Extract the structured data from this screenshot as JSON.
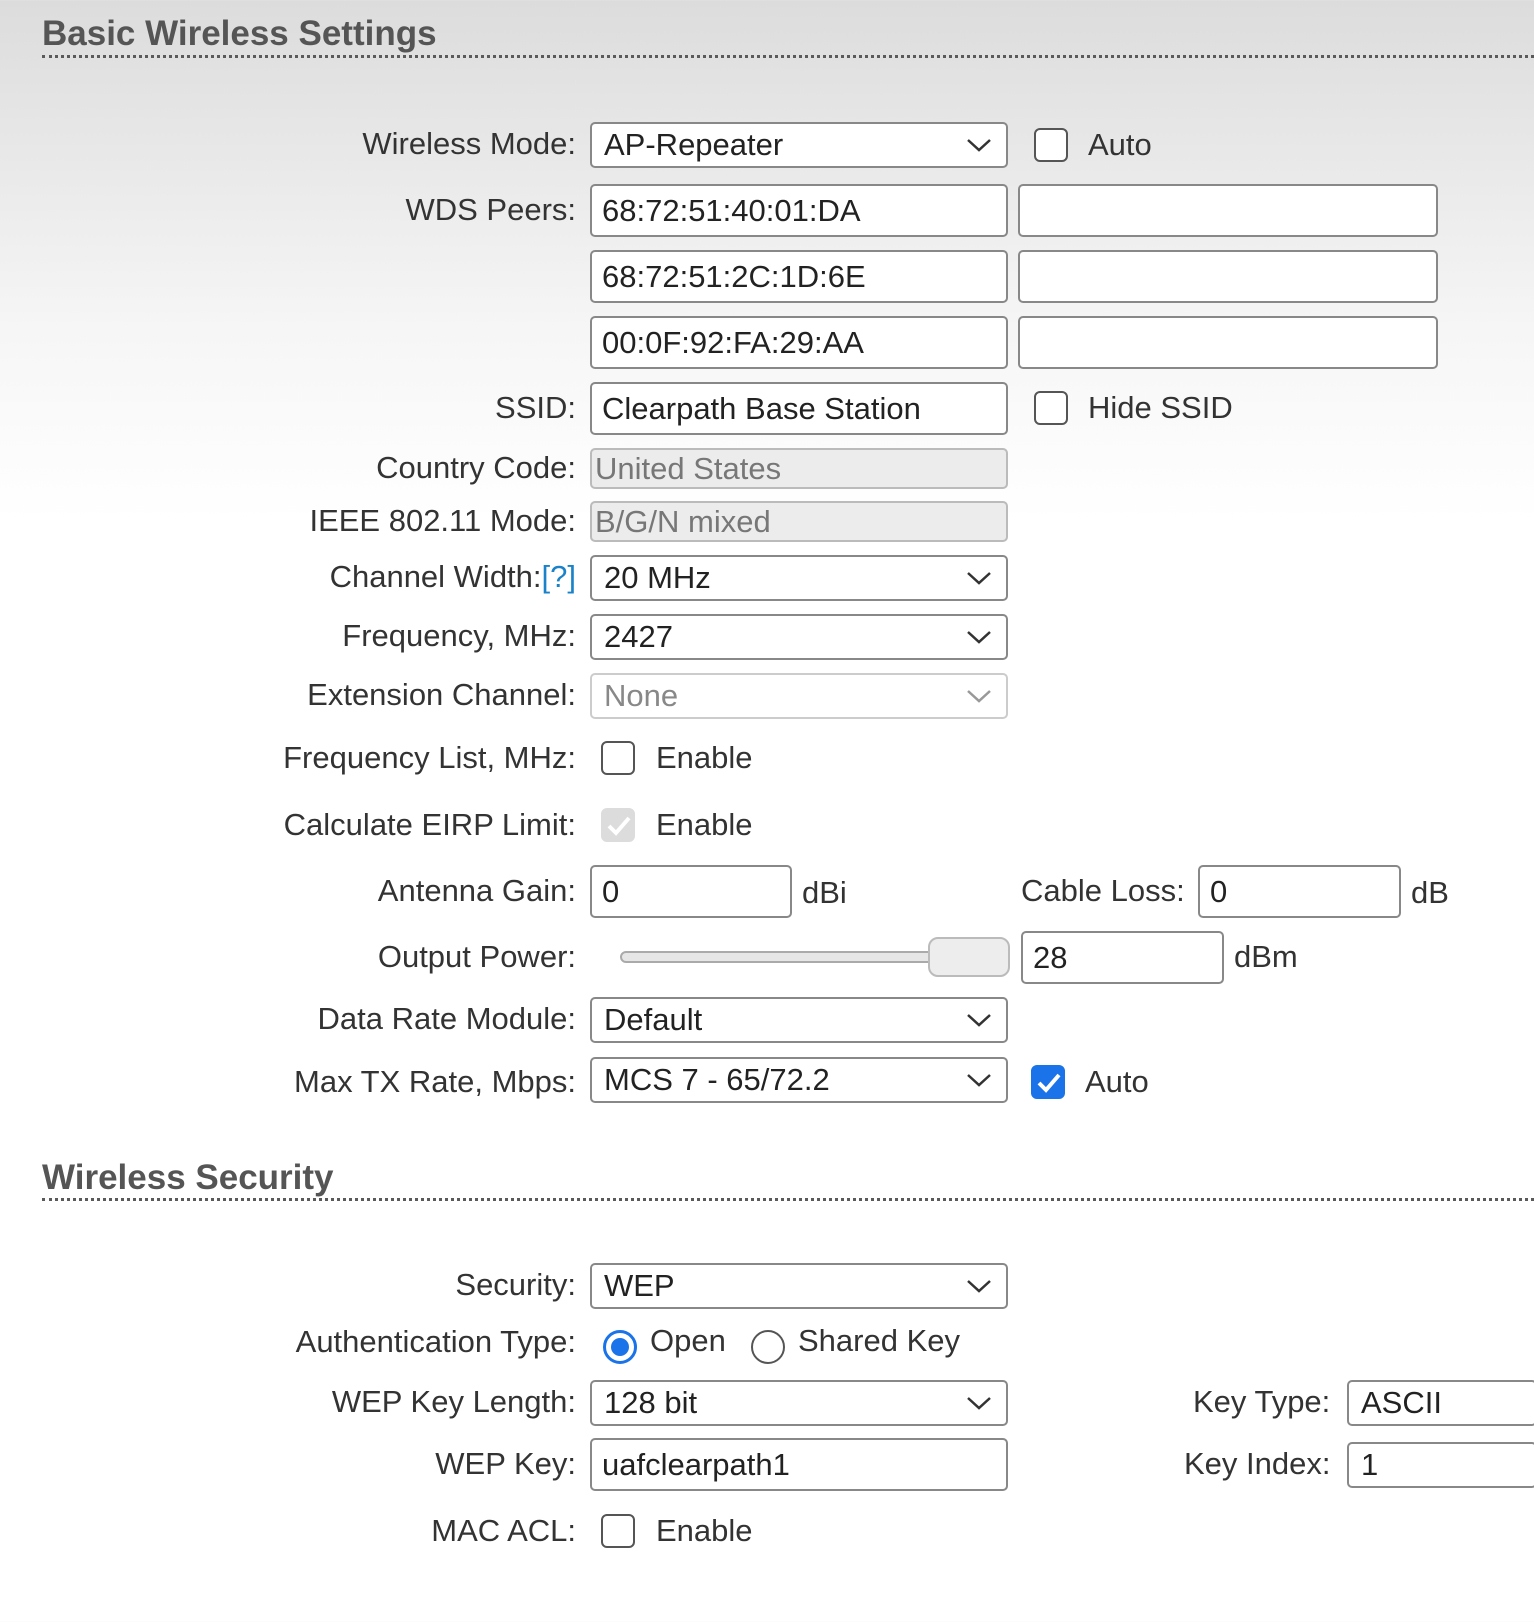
{
  "basic": {
    "title": "Basic Wireless Settings",
    "wireless_mode": {
      "label": "Wireless Mode:",
      "value": "AP-Repeater",
      "auto_label": "Auto",
      "auto_checked": false
    },
    "wds_peers": {
      "label": "WDS Peers:",
      "values": [
        "68:72:51:40:01:DA",
        "68:72:51:2C:1D:6E",
        "00:0F:92:FA:29:AA",
        "",
        "",
        ""
      ]
    },
    "ssid": {
      "label": "SSID:",
      "value": "Clearpath Base Station",
      "hide_label": "Hide SSID",
      "hide_checked": false
    },
    "country_code": {
      "label": "Country Code:",
      "value": "United States"
    },
    "ieee_mode": {
      "label": "IEEE 802.11 Mode:",
      "value": "B/G/N mixed"
    },
    "channel_width": {
      "label": "Channel Width:",
      "help": "[?]",
      "value": "20 MHz"
    },
    "frequency": {
      "label": "Frequency, MHz:",
      "value": "2427"
    },
    "extension_channel": {
      "label": "Extension Channel:",
      "value": "None"
    },
    "frequency_list": {
      "label": "Frequency List, MHz:",
      "enable_label": "Enable",
      "checked": false
    },
    "eirp_limit": {
      "label": "Calculate EIRP Limit:",
      "enable_label": "Enable",
      "checked": true
    },
    "antenna_gain": {
      "label": "Antenna Gain:",
      "value": "0",
      "unit": "dBi"
    },
    "cable_loss": {
      "label": "Cable Loss:",
      "value": "0",
      "unit": "dB"
    },
    "output_power": {
      "label": "Output Power:",
      "value": "28",
      "unit": "dBm",
      "slider_fraction": 1.0
    },
    "data_rate_module": {
      "label": "Data Rate Module:",
      "value": "Default"
    },
    "max_tx_rate": {
      "label": "Max TX Rate, Mbps:",
      "value": "MCS 7 - 65/72.2",
      "auto_label": "Auto",
      "auto_checked": true
    }
  },
  "security": {
    "title": "Wireless Security",
    "security": {
      "label": "Security:",
      "value": "WEP"
    },
    "auth_type": {
      "label": "Authentication Type:",
      "options": [
        "Open",
        "Shared Key"
      ],
      "selected": "Open"
    },
    "wep_key_length": {
      "label": "WEP Key Length:",
      "value": "128 bit"
    },
    "key_type": {
      "label": "Key Type:",
      "value": "ASCII"
    },
    "wep_key": {
      "label": "WEP Key:",
      "value": "uafclearpath1"
    },
    "key_index": {
      "label": "Key Index:",
      "value": "1"
    },
    "mac_acl": {
      "label": "MAC ACL:",
      "enable_label": "Enable",
      "checked": false
    }
  },
  "colors": {
    "accent": "#1a73e8",
    "help_link": "#1a82c8"
  }
}
